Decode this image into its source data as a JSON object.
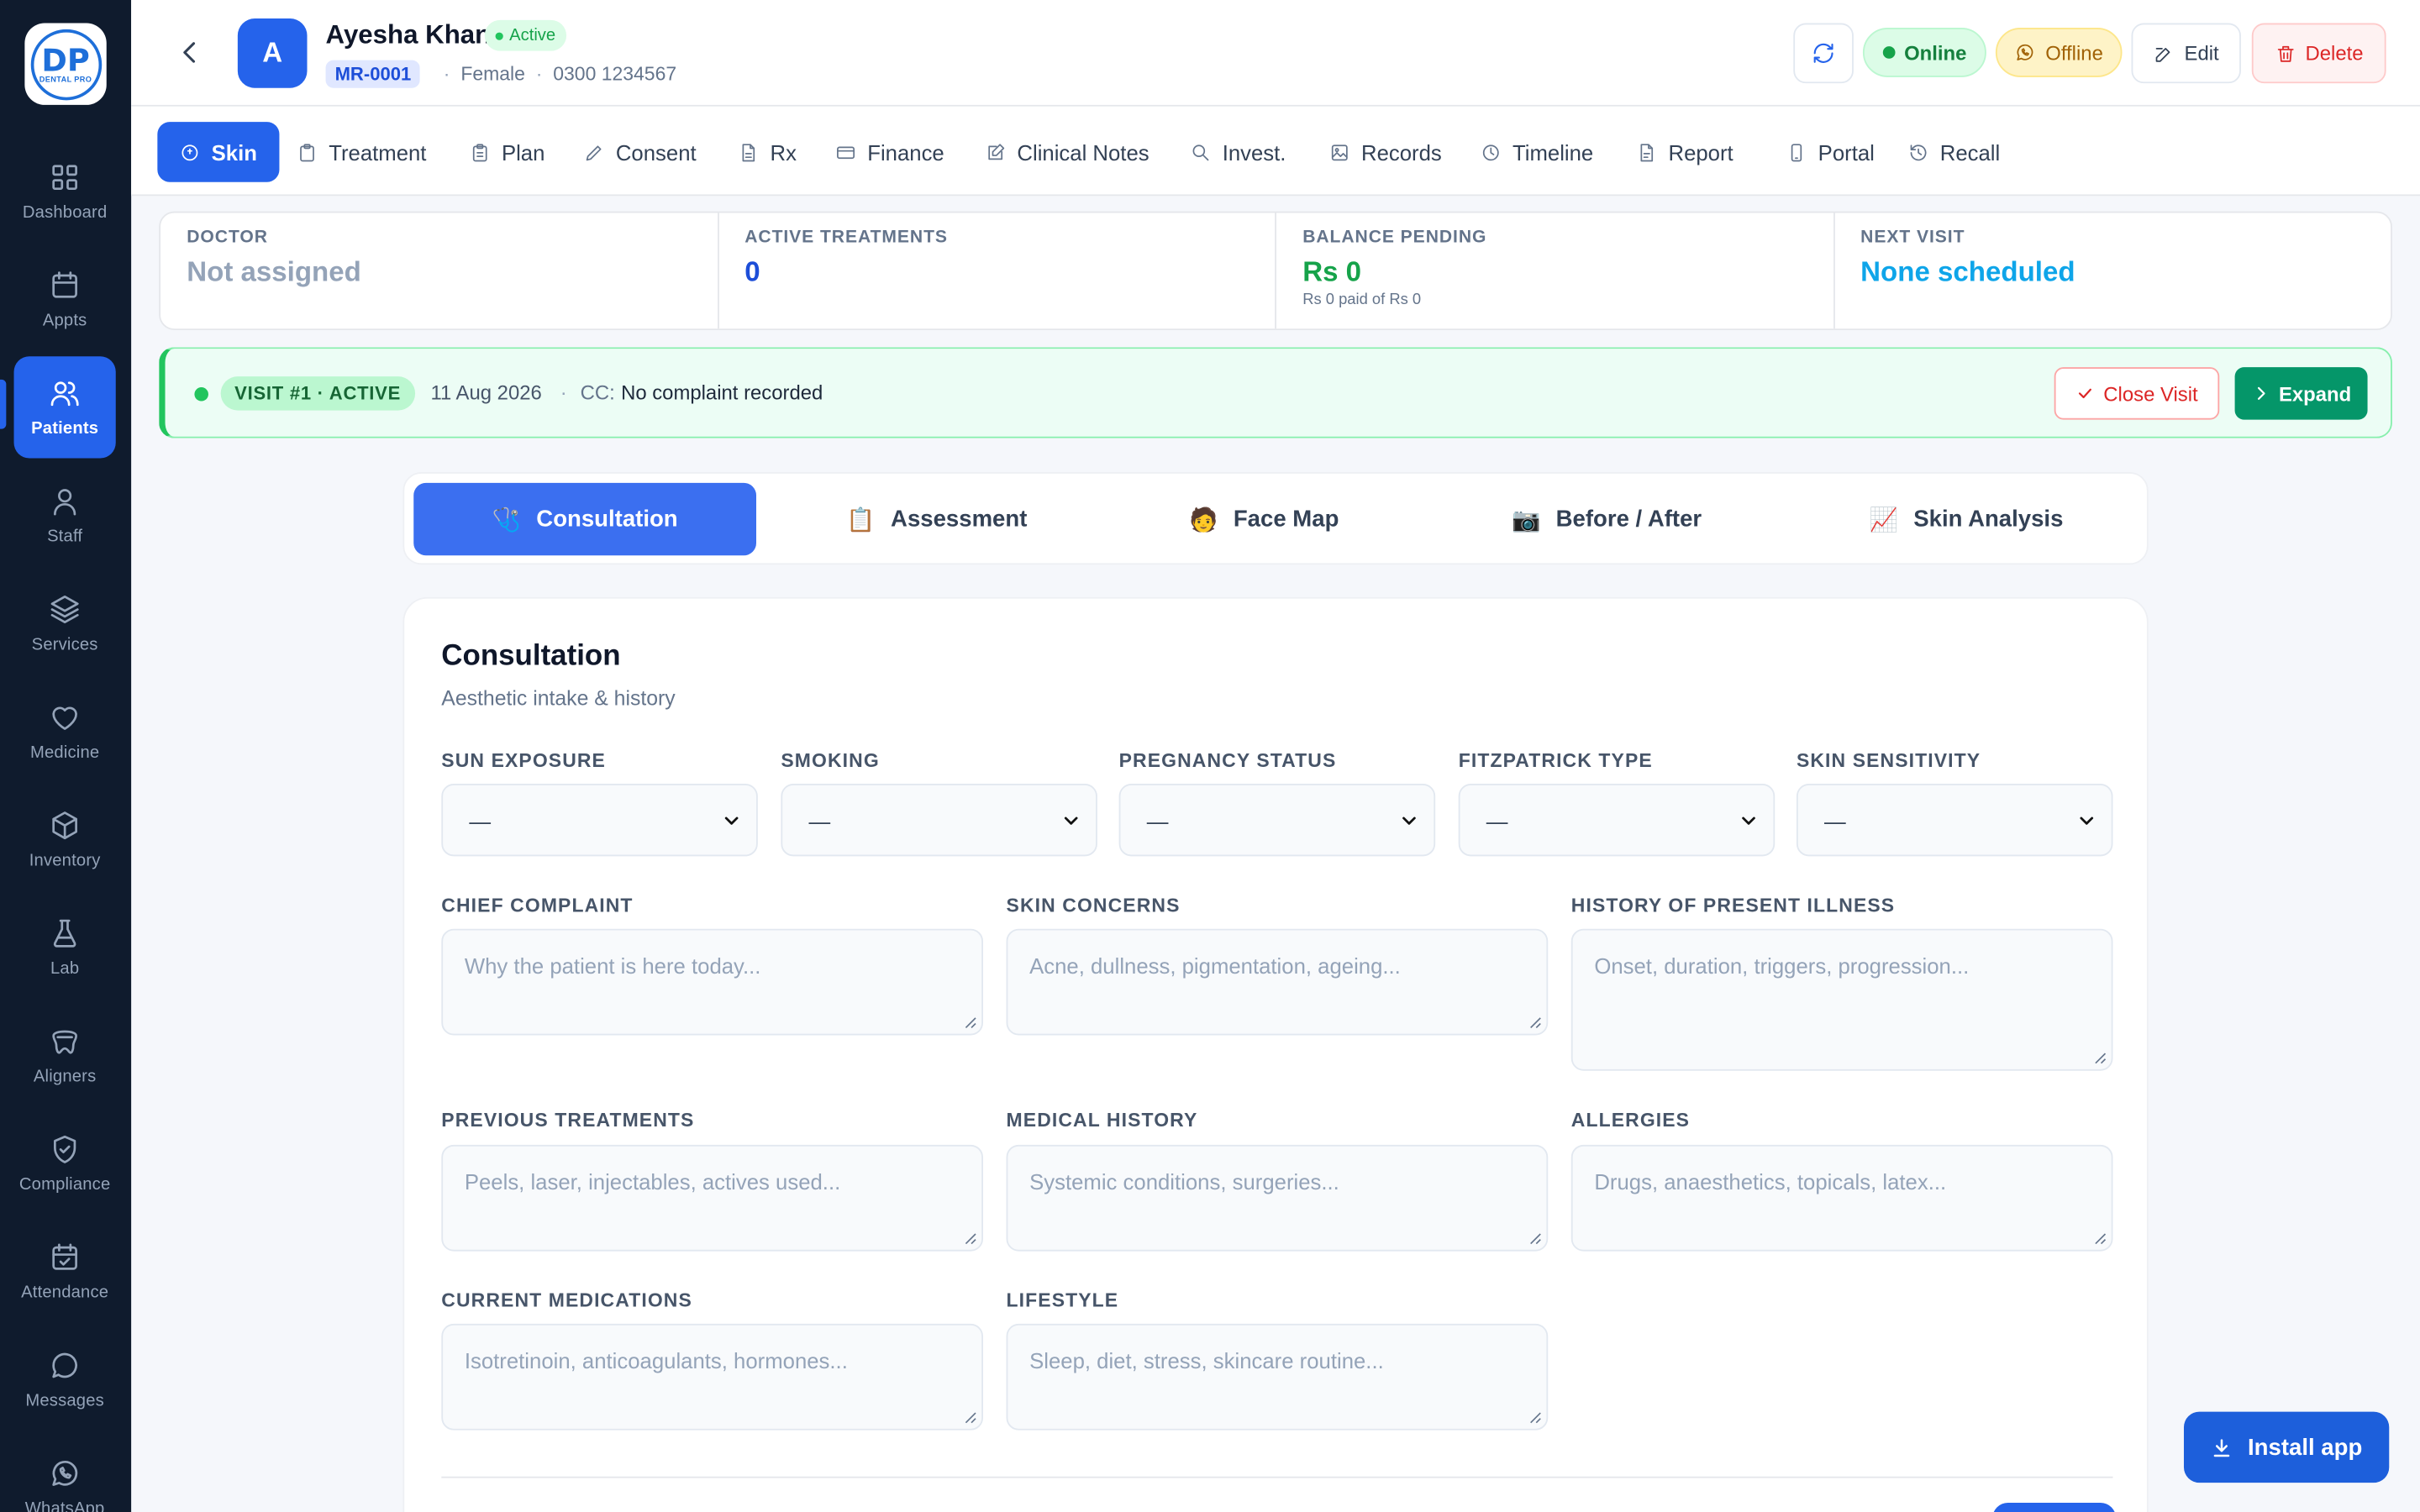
{
  "logo": {
    "mark": "DP",
    "text": "DENTAL PRO"
  },
  "sidebar": {
    "items": [
      {
        "label": "Dashboard",
        "icon": "grid-icon"
      },
      {
        "label": "Appts",
        "icon": "calendar-icon"
      },
      {
        "label": "Patients",
        "icon": "users-icon"
      },
      {
        "label": "Staff",
        "icon": "user-icon"
      },
      {
        "label": "Services",
        "icon": "layers-icon"
      },
      {
        "label": "Medicine",
        "icon": "heart-icon"
      },
      {
        "label": "Inventory",
        "icon": "box-icon"
      },
      {
        "label": "Lab",
        "icon": "flask-icon"
      },
      {
        "label": "Aligners",
        "icon": "aligner-icon"
      },
      {
        "label": "Compliance",
        "icon": "shield-check-icon"
      },
      {
        "label": "Attendance",
        "icon": "calendar-check-icon"
      },
      {
        "label": "Messages",
        "icon": "message-icon"
      },
      {
        "label": "WhatsApp",
        "icon": "whatsapp-icon"
      }
    ]
  },
  "patient": {
    "initial": "A",
    "name": "Ayesha Khan",
    "status": "Active",
    "mr": "MR-0001",
    "gender": "Female",
    "phone": "0300 1234567"
  },
  "header": {
    "online": "Online",
    "offline": "Offline",
    "edit": "Edit",
    "delete": "Delete"
  },
  "tabs": [
    {
      "label": "Skin",
      "icon": "skin-icon"
    },
    {
      "label": "Treatment",
      "icon": "clipboard-icon"
    },
    {
      "label": "Plan",
      "icon": "clipboard-list-icon"
    },
    {
      "label": "Consent",
      "icon": "pen-icon"
    },
    {
      "label": "Rx",
      "icon": "file-icon"
    },
    {
      "label": "Finance",
      "icon": "card-icon"
    },
    {
      "label": "Clinical Notes",
      "icon": "edit-icon"
    },
    {
      "label": "Invest.",
      "icon": "search-icon"
    },
    {
      "label": "Records",
      "icon": "image-icon"
    },
    {
      "label": "Timeline",
      "icon": "clock-icon"
    },
    {
      "label": "Report",
      "icon": "report-icon"
    },
    {
      "label": "Portal",
      "icon": "phone-icon"
    },
    {
      "label": "Recall",
      "icon": "history-icon"
    }
  ],
  "stats": {
    "doctor": {
      "label": "DOCTOR",
      "value": "Not assigned"
    },
    "active": {
      "label": "ACTIVE TREATMENTS",
      "value": "0"
    },
    "balance": {
      "label": "BALANCE PENDING",
      "value": "Rs 0",
      "sub": "Rs 0 paid of Rs 0"
    },
    "next": {
      "label": "NEXT VISIT",
      "value": "None scheduled"
    }
  },
  "visit": {
    "badge": "VISIT #1 · ACTIVE",
    "date": "11 Aug 2026",
    "sep": "·",
    "cc_label": "CC:",
    "cc_value": "No complaint recorded",
    "close": "Close Visit",
    "expand": "Expand"
  },
  "subtabs": [
    {
      "label": "Consultation",
      "emoji": "🩺"
    },
    {
      "label": "Assessment",
      "emoji": "📋"
    },
    {
      "label": "Face Map",
      "emoji": "🧑"
    },
    {
      "label": "Before / After",
      "emoji": "📷"
    },
    {
      "label": "Skin Analysis",
      "emoji": "📈"
    }
  ],
  "form": {
    "title": "Consultation",
    "subtitle": "Aesthetic intake & history",
    "selects": [
      {
        "label": "SUN EXPOSURE",
        "value": "—"
      },
      {
        "label": "SMOKING",
        "value": "—"
      },
      {
        "label": "PREGNANCY STATUS",
        "value": "—"
      },
      {
        "label": "FITZPATRICK TYPE",
        "value": "—"
      },
      {
        "label": "SKIN SENSITIVITY",
        "value": "—"
      }
    ],
    "fields": [
      {
        "label": "CHIEF COMPLAINT",
        "placeholder": "Why the patient is here today..."
      },
      {
        "label": "SKIN CONCERNS",
        "placeholder": "Acne, dullness, pigmentation, ageing..."
      },
      {
        "label": "HISTORY OF PRESENT ILLNESS",
        "placeholder": "Onset, duration, triggers, progression..."
      },
      {
        "label": "PREVIOUS TREATMENTS",
        "placeholder": "Peels, laser, injectables, actives used..."
      },
      {
        "label": "MEDICAL HISTORY",
        "placeholder": "Systemic conditions, surgeries..."
      },
      {
        "label": "ALLERGIES",
        "placeholder": "Drugs, anaesthetics, topicals, latex..."
      },
      {
        "label": "CURRENT MEDICATIONS",
        "placeholder": "Isotretinoin, anticoagulants, hormones..."
      },
      {
        "label": "LIFESTYLE",
        "placeholder": "Sleep, diet, stress, skincare routine..."
      }
    ]
  },
  "install": "Install app",
  "colors": {
    "primary": "#2563eb",
    "sidebar": "#0f1b2d",
    "success": "#16a34a",
    "danger": "#dc2626",
    "info": "#0ea5e9"
  }
}
